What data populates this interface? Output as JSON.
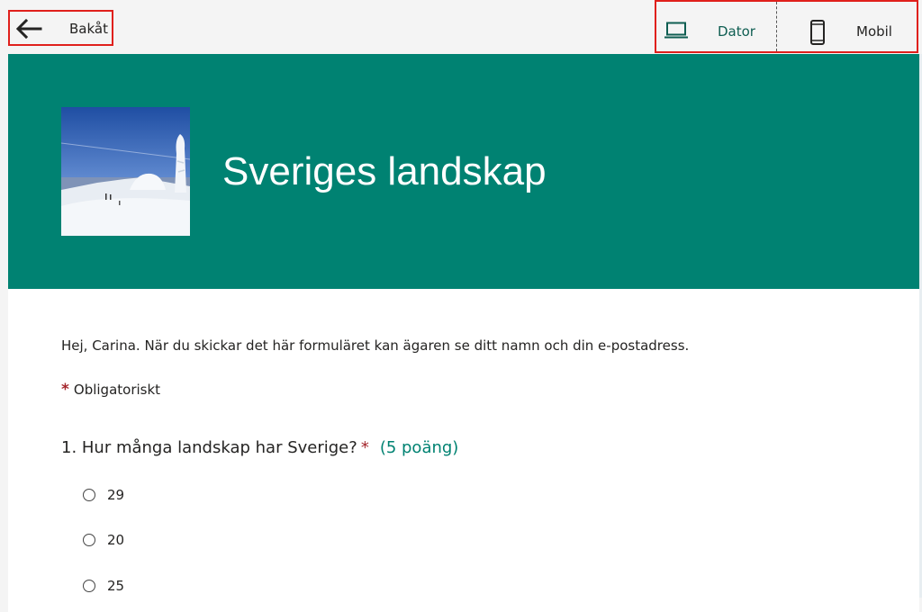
{
  "topbar": {
    "back_label": "Bakåt",
    "views": [
      {
        "label": "Dator",
        "icon": "laptop-icon",
        "selected": true
      },
      {
        "label": "Mobil",
        "icon": "mobile-phone-icon",
        "selected": false
      }
    ]
  },
  "form": {
    "title": "Sveriges landskap",
    "header_color": "#008272",
    "header_image": "snowy-mountain-image",
    "intro": "Hej, Carina. När du skickar det här formuläret kan ägaren se ditt namn och din e-postadress.",
    "required_marker": "*",
    "required_label": "Obligatoriskt",
    "questions": [
      {
        "text": "1. Hur många landskap har Sverige?",
        "required_marker": "*",
        "points": "(5 poäng)",
        "options": [
          "29",
          "20",
          "25"
        ]
      }
    ]
  },
  "colors": {
    "accent": "#008272",
    "highlight_border": "#e0201c",
    "required": "#a4262c"
  }
}
